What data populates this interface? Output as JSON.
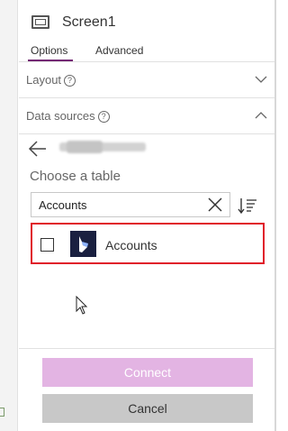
{
  "screen": {
    "title": "Screen1"
  },
  "tabs": [
    {
      "label": "Options",
      "active": true
    },
    {
      "label": "Advanced",
      "active": false
    }
  ],
  "sections": {
    "layout": {
      "label": "Layout",
      "info_icon": "?",
      "chevron": "chevron-down-icon"
    },
    "data_sources": {
      "label": "Data sources",
      "info_icon": "?",
      "chevron": "chevron-up-icon"
    }
  },
  "picker": {
    "back_icon": "back-arrow-icon",
    "connection_name_redacted": true,
    "choose_label": "Choose a table",
    "search": {
      "value": "Accounts",
      "placeholder": ""
    },
    "tables": [
      {
        "label": "Accounts",
        "checked": false,
        "icon": "dynamics-365-icon",
        "highlighted": true
      }
    ]
  },
  "buttons": {
    "connect": "Connect",
    "cancel": "Cancel"
  },
  "colors": {
    "accent": "#742774",
    "connect_disabled": "#e3b4e3",
    "cancel_bg": "#c8c8c8",
    "highlight_border": "#e01a2a",
    "dynamics_logo_bg": "#1a2040"
  }
}
